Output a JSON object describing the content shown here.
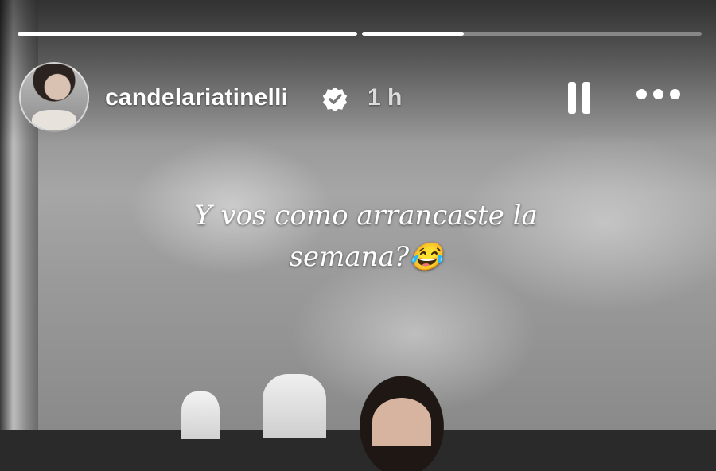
{
  "story": {
    "username": "candelariatinelli",
    "time": "1 h",
    "caption": "Y vos como arrancaste la semana?😂",
    "progress": [
      1.0,
      0.3
    ]
  },
  "icons": {
    "verified": "verified-badge-icon",
    "pause": "pause-icon",
    "more": "more-options-icon"
  }
}
